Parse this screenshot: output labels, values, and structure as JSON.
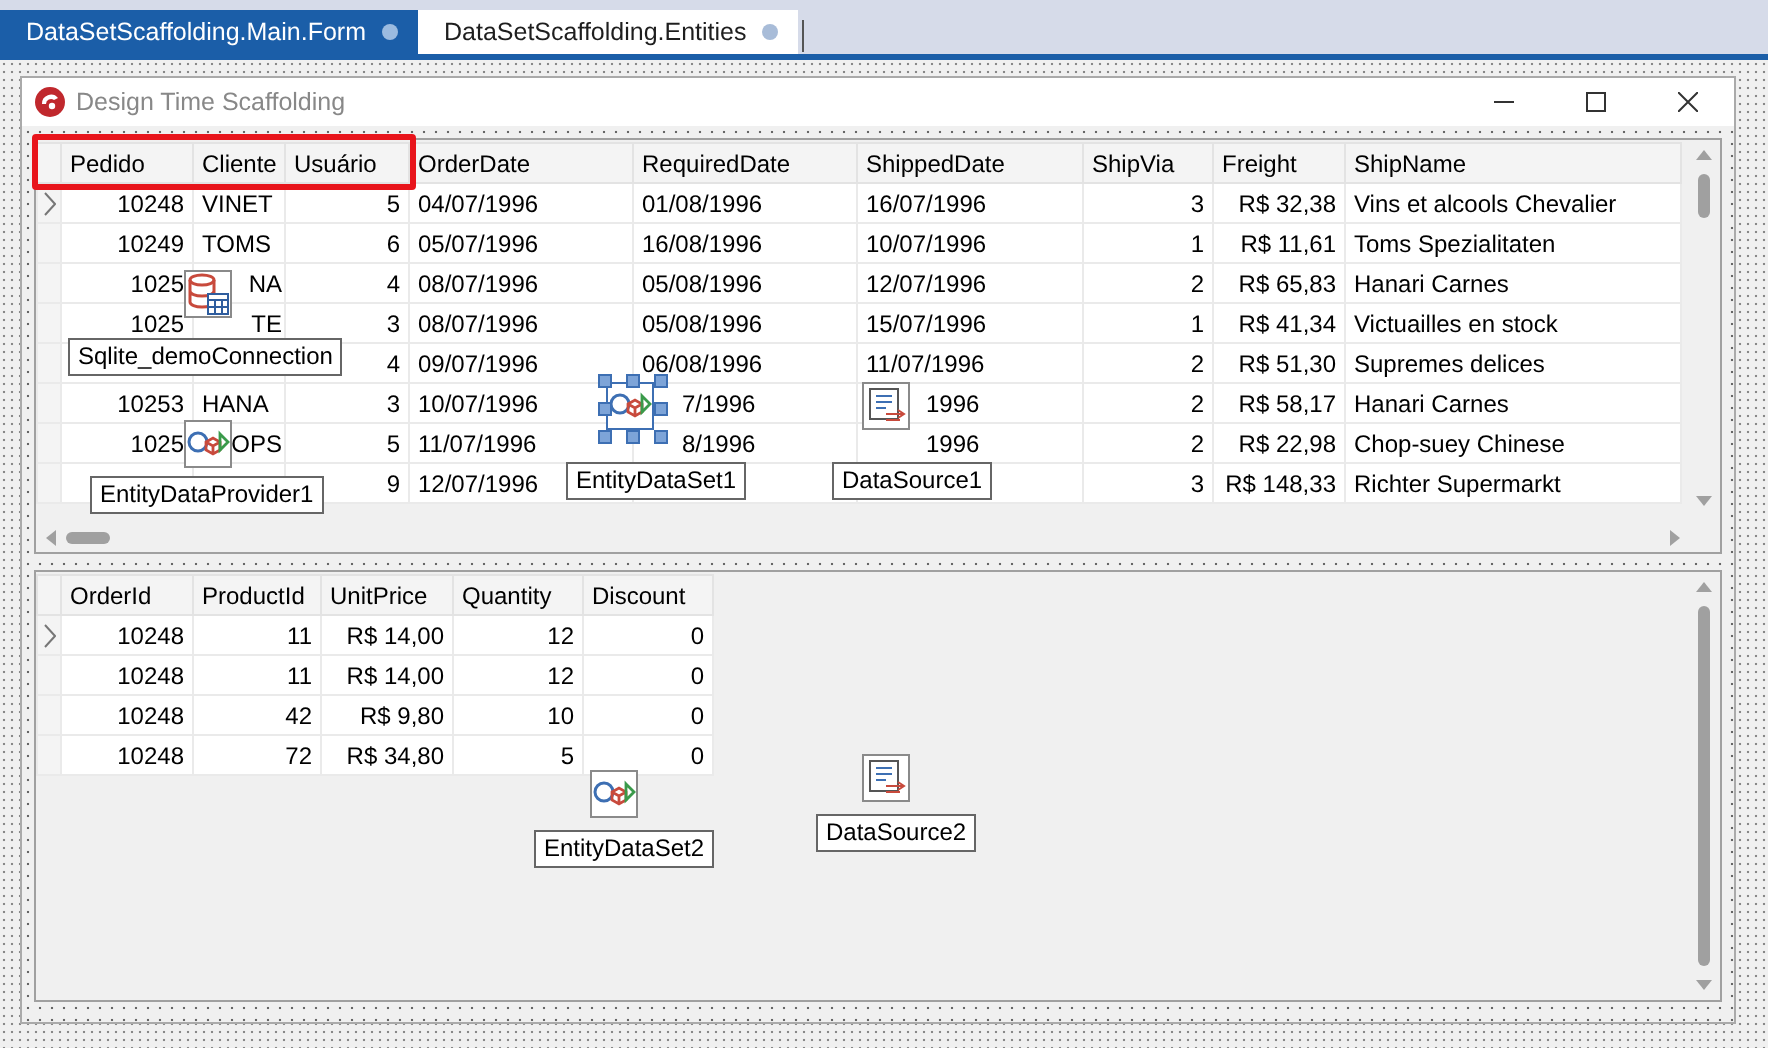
{
  "tabs": [
    {
      "label": "DataSetScaffolding.Main.Form",
      "selected": true
    },
    {
      "label": "DataSetScaffolding.Entities",
      "selected": false
    }
  ],
  "form": {
    "title": "Design Time Scaffolding"
  },
  "master_grid": {
    "columns": [
      {
        "label": "Pedido"
      },
      {
        "label": "Cliente"
      },
      {
        "label": "Usuário"
      },
      {
        "label": "OrderDate"
      },
      {
        "label": "RequiredDate"
      },
      {
        "label": "ShippedDate"
      },
      {
        "label": "ShipVia"
      },
      {
        "label": "Freight"
      },
      {
        "label": "ShipName"
      }
    ],
    "rows": [
      {
        "current": true,
        "cells": [
          "10248",
          "VINET",
          "5",
          "04/07/1996",
          "01/08/1996",
          "16/07/1996",
          "3",
          "R$ 32,38",
          "Vins et alcools Chevalier"
        ]
      },
      {
        "current": false,
        "cells": [
          "10249",
          "TOMS",
          "6",
          "05/07/1996",
          "16/08/1996",
          "10/07/1996",
          "1",
          "R$ 11,61",
          "Toms Spezialitaten"
        ]
      },
      {
        "current": false,
        "cells": [
          "1025",
          "NA",
          "4",
          "08/07/1996",
          "05/08/1996",
          "12/07/1996",
          "2",
          "R$ 65,83",
          "Hanari Carnes"
        ]
      },
      {
        "current": false,
        "cells": [
          "1025",
          "TE",
          "3",
          "08/07/1996",
          "05/08/1996",
          "15/07/1996",
          "1",
          "R$ 41,34",
          "Victuailles en stock"
        ]
      },
      {
        "current": false,
        "cells": [
          "",
          "",
          "4",
          "09/07/1996",
          "06/08/1996",
          "11/07/1996",
          "2",
          "R$ 51,30",
          "Supremes delices"
        ]
      },
      {
        "current": false,
        "cells": [
          "10253",
          "HANA",
          "3",
          "10/07/1996",
          "7/1996",
          "1996",
          "2",
          "R$ 58,17",
          "Hanari Carnes"
        ]
      },
      {
        "current": false,
        "cells": [
          "1025",
          "OPS",
          "5",
          "11/07/1996",
          "8/1996",
          "1996",
          "2",
          "R$ 22,98",
          "Chop-suey Chinese"
        ]
      },
      {
        "current": false,
        "cells": [
          "",
          "",
          "9",
          "12/07/1996",
          "",
          "",
          "3",
          "R$ 148,33",
          "Richter Supermarkt"
        ]
      }
    ]
  },
  "detail_grid": {
    "columns": [
      {
        "label": "OrderId"
      },
      {
        "label": "ProductId"
      },
      {
        "label": "UnitPrice"
      },
      {
        "label": "Quantity"
      },
      {
        "label": "Discount"
      }
    ],
    "rows": [
      {
        "current": true,
        "cells": [
          "10248",
          "11",
          "R$ 14,00",
          "12",
          "0"
        ]
      },
      {
        "current": false,
        "cells": [
          "10248",
          "11",
          "R$ 14,00",
          "12",
          "0"
        ]
      },
      {
        "current": false,
        "cells": [
          "10248",
          "42",
          "R$ 9,80",
          "10",
          "0"
        ]
      },
      {
        "current": false,
        "cells": [
          "10248",
          "72",
          "R$ 34,80",
          "5",
          "0"
        ]
      }
    ]
  },
  "components": [
    {
      "name": "Sqlite_demoConnection",
      "kind": "connection",
      "selected": false
    },
    {
      "name": "EntityDataProvider1",
      "kind": "provider",
      "selected": false
    },
    {
      "name": "EntityDataSet1",
      "kind": "dataset",
      "selected": true
    },
    {
      "name": "DataSource1",
      "kind": "datasource",
      "selected": false
    },
    {
      "name": "EntityDataSet2",
      "kind": "dataset",
      "selected": false
    },
    {
      "name": "DataSource2",
      "kind": "datasource",
      "selected": false
    }
  ]
}
